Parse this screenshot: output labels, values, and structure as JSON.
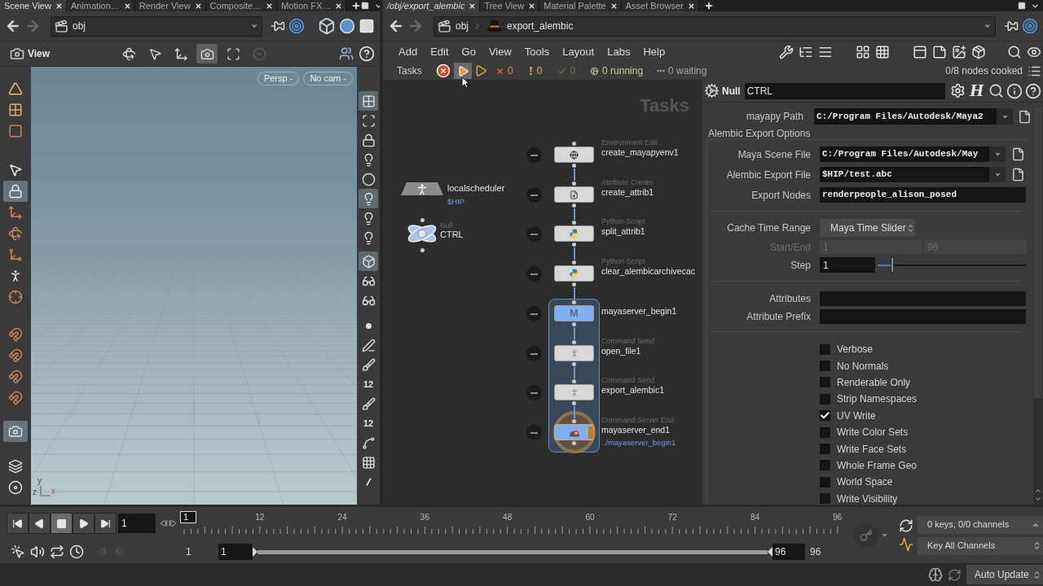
{
  "left_pane": {
    "tabs": [
      {
        "label": "Scene View",
        "selected": true
      },
      {
        "label": "Animation…",
        "selected": false
      },
      {
        "label": "Render View",
        "selected": false
      },
      {
        "label": "Composite…",
        "selected": false
      },
      {
        "label": "Motion FX…",
        "selected": false
      }
    ],
    "path": "obj",
    "view_toolbar": {
      "label": "View",
      "tools": [
        {
          "pressed": false
        },
        {
          "pressed": false
        },
        {
          "pressed": false
        },
        {
          "pressed": true
        },
        {
          "pressed": false
        },
        {
          "pressed": false
        }
      ]
    },
    "left_toolbar": [
      {
        "pressed": false
      },
      {
        "pressed": false
      },
      {
        "pressed": false
      },
      {
        "pressed": false
      },
      {
        "pressed": true
      },
      {
        "pressed": false
      },
      {
        "pressed": false
      },
      {
        "pressed": false
      },
      {
        "pressed": false
      },
      {
        "pressed": false
      },
      {
        "pressed": false
      },
      {
        "pressed": false
      },
      {
        "pressed": false
      },
      {
        "pressed": false
      },
      {
        "pressed": true
      },
      {
        "pressed": false
      },
      {
        "pressed": false
      }
    ],
    "viewport": {
      "camera_menus": [
        "Persp -",
        "No cam -"
      ],
      "axis_labels": [
        "y",
        "z",
        "x"
      ]
    },
    "right_toolbar": [
      {
        "pressed": true
      },
      {
        "pressed": false
      },
      {
        "pressed": false
      },
      {
        "pressed": false
      },
      {
        "pressed": false
      },
      {
        "pressed": true
      },
      {
        "pressed": false
      },
      {
        "pressed": false
      },
      {
        "pressed": true
      },
      {
        "pressed": false
      },
      {
        "pressed": false
      },
      {
        "pressed": false
      },
      {
        "pressed": false
      },
      {
        "pressed": false
      },
      {
        "pressed": false,
        "label": "12"
      },
      {
        "pressed": false
      },
      {
        "pressed": false,
        "label": "12"
      },
      {
        "pressed": false
      },
      {
        "pressed": false
      },
      {
        "pressed": false
      }
    ]
  },
  "right_pane": {
    "tabs": [
      {
        "label": "/obj/export_alembic",
        "selected": true
      },
      {
        "label": "Tree View",
        "selected": false
      },
      {
        "label": "Material Palette",
        "selected": false
      },
      {
        "label": "Asset Browser",
        "selected": false
      }
    ],
    "path": [
      "obj",
      "export_alembic"
    ],
    "menu": [
      "Add",
      "Edit",
      "Go",
      "View",
      "Tools",
      "Layout",
      "Labs",
      "Help"
    ],
    "tasks_bar": {
      "label": "Tasks",
      "cook_button": {
        "hovered": true
      },
      "failed": "0",
      "warnings": "0",
      "succeeded": "0",
      "running": "0 running",
      "waiting": "0 waiting",
      "cooked": "0/8 nodes cooked"
    },
    "network": {
      "context_label": "Tasks",
      "scheduler": {
        "name": "localscheduler",
        "subtitle": "$HIP"
      },
      "null_node": {
        "type": "Null",
        "name": "CTRL"
      },
      "chain": [
        {
          "kind": "task",
          "type": "Environment Edit",
          "name": "create_mayapyenv1",
          "output": false
        },
        {
          "kind": "task",
          "type": "Attribute Create",
          "name": "create_attrib1",
          "output": false
        },
        {
          "kind": "task",
          "type": "Python Script",
          "name": "split_attrib1",
          "output": false
        },
        {
          "kind": "task",
          "type": "Python Script",
          "name": "clear_alembicarchivecac",
          "output": false
        }
      ],
      "block": {
        "nodes": [
          {
            "kind": "block_begin",
            "name": "mayaserver_begin1",
            "icon_text": "M",
            "output": false
          },
          {
            "kind": "task",
            "type": "Command Send",
            "name": "open_file1",
            "output": false
          },
          {
            "kind": "task",
            "type": "Command Send",
            "name": "export_alembic1",
            "output": false
          },
          {
            "kind": "block_end",
            "type": "Command Server End",
            "name": "mayaserver_end1",
            "subtitle": "../mayaserver_begin1",
            "output": true
          }
        ]
      }
    }
  },
  "parameters": {
    "node_type": "Null",
    "node_name": "CTRL",
    "header_logo_text": "H",
    "mayapy_path": {
      "label": "mayapy Path",
      "value": "C:/Program Files/Autodesk/Maya2"
    },
    "group_title": "Alembic Export Options",
    "file_fields": [
      {
        "label": "Maya Scene File",
        "value": "C:/Program Files/Autodesk/May"
      },
      {
        "label": "Alembic Export File",
        "value": "$HIP/test.abc"
      }
    ],
    "export_nodes": {
      "label": "Export Nodes",
      "value": "renderpeople_alison_posed"
    },
    "cache_time_range": {
      "label": "Cache Time Range",
      "value": "Maya Time Slider"
    },
    "start_end": {
      "label": "Start/End",
      "values": [
        "1",
        "96"
      ],
      "disabled": true
    },
    "step": {
      "label": "Step",
      "value": "1",
      "level": 0.1
    },
    "attribute_fields": [
      {
        "label": "Attributes"
      },
      {
        "label": "Attribute Prefix"
      }
    ],
    "toggles": [
      {
        "label": "Verbose",
        "checked": false
      },
      {
        "label": "No Normals",
        "checked": false
      },
      {
        "label": "Renderable Only",
        "checked": false
      },
      {
        "label": "Strip Namespaces",
        "checked": false
      },
      {
        "label": "UV Write",
        "checked": true
      },
      {
        "label": "Write Color Sets",
        "checked": false
      },
      {
        "label": "Write Face Sets",
        "checked": false
      },
      {
        "label": "Whole Frame Geo",
        "checked": false
      },
      {
        "label": "World Space",
        "checked": false
      },
      {
        "label": "Write Visibility",
        "checked": false
      }
    ]
  },
  "timeline": {
    "playback": [
      {
        "pressed": false
      },
      {
        "pressed": false
      },
      {
        "pressed": true
      },
      {
        "pressed": false
      },
      {
        "pressed": false
      }
    ],
    "frame": "1",
    "ruler_ticks": [
      {
        "label": "1",
        "selected": true
      },
      {
        "label": "12",
        "selected": false
      },
      {
        "label": "24",
        "selected": false
      },
      {
        "label": "36",
        "selected": false
      },
      {
        "label": "48",
        "selected": false
      },
      {
        "label": "60",
        "selected": false
      },
      {
        "label": "72",
        "selected": false
      },
      {
        "label": "84",
        "selected": false
      },
      {
        "label": "96",
        "selected": false
      }
    ],
    "range": {
      "global_start": "1",
      "playback_start": "1",
      "level": 1,
      "playback_end": "96",
      "global_end": "96"
    },
    "keys_menu": "0 keys, 0/0 channels",
    "key_mode": "Key All Channels"
  },
  "status_bar": {
    "auto_update": "Auto Update"
  }
}
